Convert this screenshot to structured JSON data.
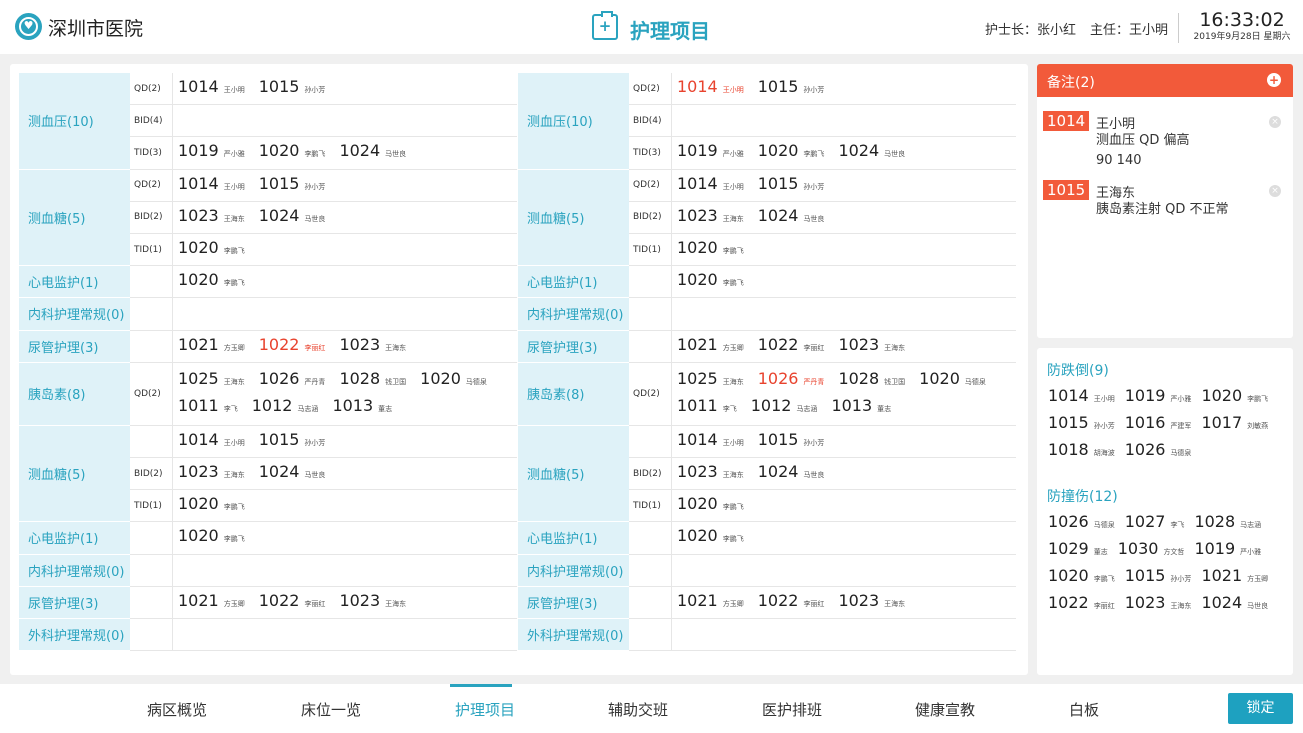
{
  "header": {
    "hospital": "深圳市医院",
    "page_title": "护理项目",
    "head_nurse_label": "护士长：张小红",
    "director_label": "主任：王小明",
    "time": "16:33:02",
    "date": "2019年9月28日 星期六"
  },
  "left": [
    {
      "cat": "测血压(10)",
      "rows": [
        {
          "freq": "QD(2)",
          "lines": [
            [
              {
                "bed": "1014",
                "name": "王小明"
              },
              {
                "bed": "1015",
                "name": "孙小芳"
              }
            ]
          ]
        },
        {
          "freq": "BID(4)",
          "lines": []
        },
        {
          "freq": "TID(3)",
          "lines": [
            [
              {
                "bed": "1019",
                "name": "严小雅"
              },
              {
                "bed": "1020",
                "name": "李鹏飞"
              },
              {
                "bed": "1024",
                "name": "马世良"
              }
            ]
          ]
        }
      ]
    },
    {
      "cat": "测血糖(5)",
      "rows": [
        {
          "freq": "QD(2)",
          "lines": [
            [
              {
                "bed": "1014",
                "name": "王小明"
              },
              {
                "bed": "1015",
                "name": "孙小芳"
              }
            ]
          ]
        },
        {
          "freq": "BID(2)",
          "lines": [
            [
              {
                "bed": "1023",
                "name": "王海东"
              },
              {
                "bed": "1024",
                "name": "马世良"
              }
            ]
          ]
        },
        {
          "freq": "TID(1)",
          "lines": [
            [
              {
                "bed": "1020",
                "name": "李鹏飞"
              }
            ]
          ]
        }
      ]
    },
    {
      "cat": "心电监护(1)",
      "rows": [
        {
          "freq": "",
          "lines": [
            [
              {
                "bed": "1020",
                "name": "李鹏飞"
              }
            ]
          ]
        }
      ]
    },
    {
      "cat": "内科护理常规(0)",
      "rows": [
        {
          "freq": "",
          "lines": []
        }
      ]
    },
    {
      "cat": "尿管护理(3)",
      "rows": [
        {
          "freq": "",
          "lines": [
            [
              {
                "bed": "1021",
                "name": "方玉卿"
              },
              {
                "bed": "1022",
                "name": "李丽红",
                "red": true
              },
              {
                "bed": "1023",
                "name": "王海东"
              }
            ]
          ]
        }
      ]
    },
    {
      "cat": "胰岛素(8)",
      "rows": [
        {
          "freq": "QD(2)",
          "lines": [
            [
              {
                "bed": "1025",
                "name": "王海东"
              },
              {
                "bed": "1026",
                "name": "严丹青"
              },
              {
                "bed": "1028",
                "name": "钱卫国"
              },
              {
                "bed": "1020",
                "name": "马德泉"
              }
            ],
            [
              {
                "bed": "1011",
                "name": "李飞"
              },
              {
                "bed": "1012",
                "name": "马志涵"
              },
              {
                "bed": "1013",
                "name": "董志"
              }
            ]
          ]
        }
      ]
    },
    {
      "cat": "测血糖(5)",
      "rows": [
        {
          "freq": "",
          "lines": [
            [
              {
                "bed": "1014",
                "name": "王小明"
              },
              {
                "bed": "1015",
                "name": "孙小芳"
              }
            ]
          ]
        },
        {
          "freq": "BID(2)",
          "lines": [
            [
              {
                "bed": "1023",
                "name": "王海东"
              },
              {
                "bed": "1024",
                "name": "马世良"
              }
            ]
          ]
        },
        {
          "freq": "TID(1)",
          "lines": [
            [
              {
                "bed": "1020",
                "name": "李鹏飞"
              }
            ]
          ]
        }
      ]
    },
    {
      "cat": "心电监护(1)",
      "rows": [
        {
          "freq": "",
          "lines": [
            [
              {
                "bed": "1020",
                "name": "李鹏飞"
              }
            ]
          ]
        }
      ]
    },
    {
      "cat": "内科护理常规(0)",
      "rows": [
        {
          "freq": "",
          "lines": []
        }
      ]
    },
    {
      "cat": "尿管护理(3)",
      "rows": [
        {
          "freq": "",
          "lines": [
            [
              {
                "bed": "1021",
                "name": "方玉卿"
              },
              {
                "bed": "1022",
                "name": "李丽红"
              },
              {
                "bed": "1023",
                "name": "王海东"
              }
            ]
          ]
        }
      ]
    },
    {
      "cat": "外科护理常规(0)",
      "rows": [
        {
          "freq": "",
          "lines": []
        }
      ]
    }
  ],
  "right": [
    {
      "cat": "测血压(10)",
      "rows": [
        {
          "freq": "QD(2)",
          "lines": [
            [
              {
                "bed": "1014",
                "name": "王小明",
                "red": true
              },
              {
                "bed": "1015",
                "name": "孙小芳"
              }
            ]
          ]
        },
        {
          "freq": "BID(4)",
          "lines": []
        },
        {
          "freq": "TID(3)",
          "lines": [
            [
              {
                "bed": "1019",
                "name": "严小雅"
              },
              {
                "bed": "1020",
                "name": "李鹏飞"
              },
              {
                "bed": "1024",
                "name": "马世良"
              }
            ]
          ]
        }
      ]
    },
    {
      "cat": "测血糖(5)",
      "rows": [
        {
          "freq": "QD(2)",
          "lines": [
            [
              {
                "bed": "1014",
                "name": "王小明"
              },
              {
                "bed": "1015",
                "name": "孙小芳"
              }
            ]
          ]
        },
        {
          "freq": "BID(2)",
          "lines": [
            [
              {
                "bed": "1023",
                "name": "王海东"
              },
              {
                "bed": "1024",
                "name": "马世良"
              }
            ]
          ]
        },
        {
          "freq": "TID(1)",
          "lines": [
            [
              {
                "bed": "1020",
                "name": "李鹏飞"
              }
            ]
          ]
        }
      ]
    },
    {
      "cat": "心电监护(1)",
      "rows": [
        {
          "freq": "",
          "lines": [
            [
              {
                "bed": "1020",
                "name": "李鹏飞"
              }
            ]
          ]
        }
      ]
    },
    {
      "cat": "内科护理常规(0)",
      "rows": [
        {
          "freq": "",
          "lines": []
        }
      ]
    },
    {
      "cat": "尿管护理(3)",
      "rows": [
        {
          "freq": "",
          "lines": [
            [
              {
                "bed": "1021",
                "name": "方玉卿"
              },
              {
                "bed": "1022",
                "name": "李丽红"
              },
              {
                "bed": "1023",
                "name": "王海东"
              }
            ]
          ]
        }
      ]
    },
    {
      "cat": "胰岛素(8)",
      "rows": [
        {
          "freq": "QD(2)",
          "lines": [
            [
              {
                "bed": "1025",
                "name": "王海东"
              },
              {
                "bed": "1026",
                "name": "严丹青",
                "red": true
              },
              {
                "bed": "1028",
                "name": "钱卫国"
              },
              {
                "bed": "1020",
                "name": "马德泉"
              }
            ],
            [
              {
                "bed": "1011",
                "name": "李飞"
              },
              {
                "bed": "1012",
                "name": "马志涵"
              },
              {
                "bed": "1013",
                "name": "董志"
              }
            ]
          ]
        }
      ]
    },
    {
      "cat": "测血糖(5)",
      "rows": [
        {
          "freq": "",
          "lines": [
            [
              {
                "bed": "1014",
                "name": "王小明"
              },
              {
                "bed": "1015",
                "name": "孙小芳"
              }
            ]
          ]
        },
        {
          "freq": "BID(2)",
          "lines": [
            [
              {
                "bed": "1023",
                "name": "王海东"
              },
              {
                "bed": "1024",
                "name": "马世良"
              }
            ]
          ]
        },
        {
          "freq": "TID(1)",
          "lines": [
            [
              {
                "bed": "1020",
                "name": "李鹏飞"
              }
            ]
          ]
        }
      ]
    },
    {
      "cat": "心电监护(1)",
      "rows": [
        {
          "freq": "",
          "lines": [
            [
              {
                "bed": "1020",
                "name": "李鹏飞"
              }
            ]
          ]
        }
      ]
    },
    {
      "cat": "内科护理常规(0)",
      "rows": [
        {
          "freq": "",
          "lines": []
        }
      ]
    },
    {
      "cat": "尿管护理(3)",
      "rows": [
        {
          "freq": "",
          "lines": [
            [
              {
                "bed": "1021",
                "name": "方玉卿"
              },
              {
                "bed": "1022",
                "name": "李丽红"
              },
              {
                "bed": "1023",
                "name": "王海东"
              }
            ]
          ]
        }
      ]
    },
    {
      "cat": "外科护理常规(0)",
      "rows": [
        {
          "freq": "",
          "lines": []
        }
      ]
    }
  ],
  "notes": {
    "title": "备注(2)",
    "items": [
      {
        "bed": "1014",
        "name": "王小明",
        "lines": [
          "测血压 QD  偏高",
          "90 140"
        ]
      },
      {
        "bed": "1015",
        "name": "王海东",
        "lines": [
          "胰岛素注射  QD   不正常"
        ]
      }
    ]
  },
  "side": [
    {
      "title": "防跌倒(9)",
      "lines": [
        [
          {
            "bed": "1014",
            "name": "王小明"
          },
          {
            "bed": "1019",
            "name": "严小雅"
          },
          {
            "bed": "1020",
            "name": "李鹏飞"
          }
        ],
        [
          {
            "bed": "1015",
            "name": "孙小芳"
          },
          {
            "bed": "1016",
            "name": "严建军"
          },
          {
            "bed": "1017",
            "name": "刘敏燕"
          }
        ],
        [
          {
            "bed": "1018",
            "name": "胡海波"
          },
          {
            "bed": "1026",
            "name": "马德泉"
          }
        ]
      ]
    },
    {
      "title": "防撞伤(12)",
      "lines": [
        [
          {
            "bed": "1026",
            "name": "马德泉"
          },
          {
            "bed": "1027",
            "name": "李飞"
          },
          {
            "bed": "1028",
            "name": "马志涵"
          }
        ],
        [
          {
            "bed": "1029",
            "name": "董志"
          },
          {
            "bed": "1030",
            "name": "方文哲"
          },
          {
            "bed": "1019",
            "name": "严小雅"
          }
        ],
        [
          {
            "bed": "1020",
            "name": "李鹏飞"
          },
          {
            "bed": "1015",
            "name": "孙小芳"
          },
          {
            "bed": "1021",
            "name": "方玉卿"
          }
        ],
        [
          {
            "bed": "1022",
            "name": "李丽红"
          },
          {
            "bed": "1023",
            "name": "王海东"
          },
          {
            "bed": "1024",
            "name": "马世良"
          }
        ]
      ]
    }
  ],
  "footer": {
    "tabs": [
      "病区概览",
      "床位一览",
      "护理项目",
      "辅助交班",
      "医护排班",
      "健康宣教",
      "白板"
    ],
    "active": "护理项目",
    "lock": "锁定"
  }
}
